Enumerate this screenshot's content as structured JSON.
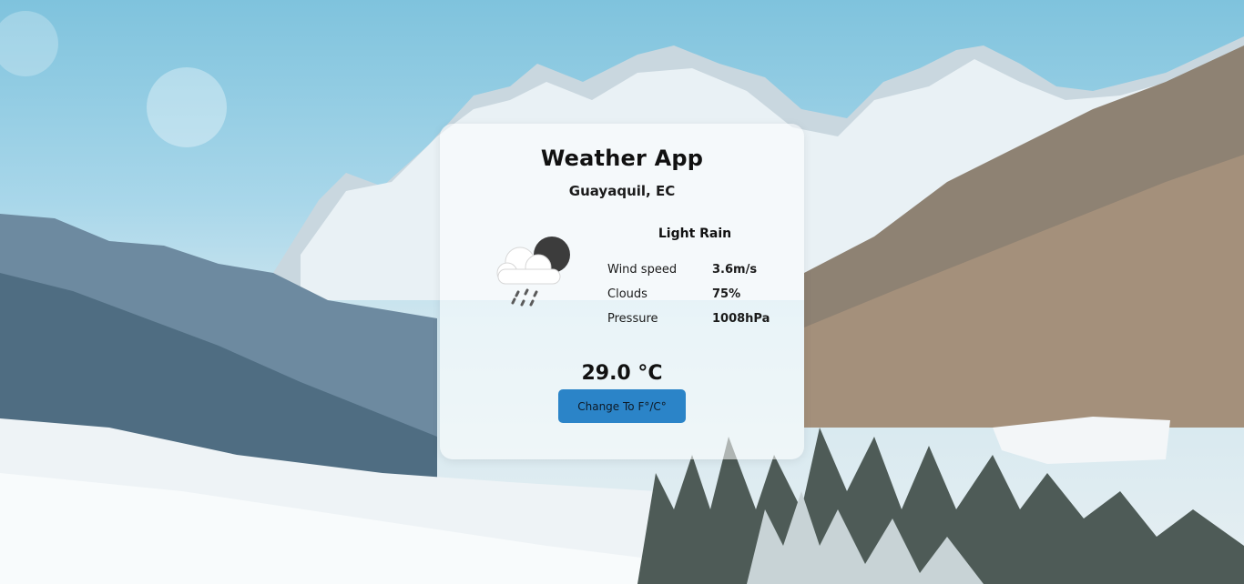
{
  "app": {
    "title": "Weather App",
    "location": "Guayaquil, EC"
  },
  "weather": {
    "icon": "cloud-rain-moon-icon",
    "description": "Light Rain",
    "details": [
      {
        "label": "Wind speed",
        "value": "3.6m/s"
      },
      {
        "label": "Clouds",
        "value": "75%"
      },
      {
        "label": "Pressure",
        "value": "1008hPa"
      }
    ],
    "temperature": "29.0 °C"
  },
  "controls": {
    "toggle_unit_label": "Change To F°/C°"
  },
  "colors": {
    "button": "#2b84c8",
    "card": "rgba(255,255,255,0.55)"
  }
}
